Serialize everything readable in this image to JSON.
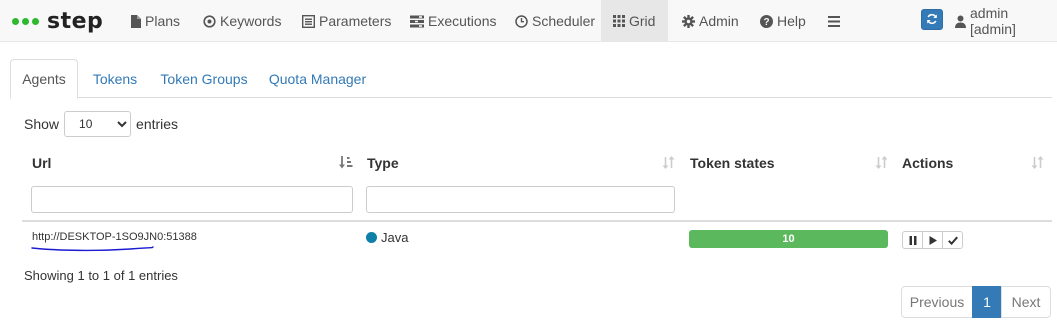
{
  "brand": {
    "name": "step"
  },
  "nav": {
    "plans": "Plans",
    "keywords": "Keywords",
    "parameters": "Parameters",
    "executions": "Executions",
    "scheduler": "Scheduler",
    "grid": "Grid",
    "admin": "Admin",
    "help": "Help"
  },
  "user": {
    "label": "admin [admin]"
  },
  "tabs": {
    "agents": "Agents",
    "tokens": "Tokens",
    "token_groups": "Token Groups",
    "quota_manager": "Quota Manager"
  },
  "length": {
    "show": "Show",
    "value": "10",
    "entries": "entries"
  },
  "table": {
    "columns": {
      "url": "Url",
      "type": "Type",
      "token_states": "Token states",
      "actions": "Actions"
    },
    "rows": [
      {
        "url": "http://DESKTOP-1SO9JN0:51388",
        "type": "Java",
        "tokens": "10"
      }
    ]
  },
  "info": "Showing 1 to 1 of 1 entries",
  "pagination": {
    "previous": "Previous",
    "current": "1",
    "next": "Next"
  },
  "colors": {
    "brand_dot": "#2db82d",
    "primary": "#337ab7",
    "success": "#5cb85c",
    "java_dot": "#0d7fa8",
    "annotation": "#1a1ad0"
  }
}
